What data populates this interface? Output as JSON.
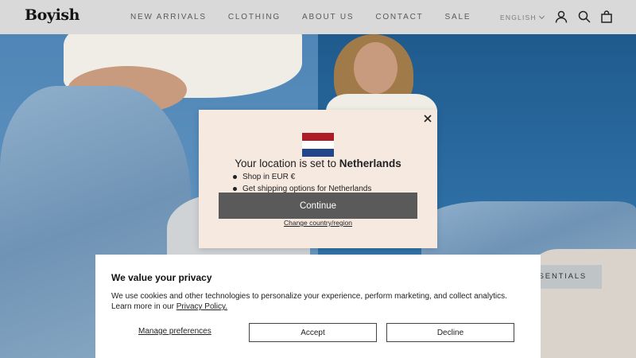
{
  "header": {
    "logo": "Boyish",
    "nav": [
      "NEW ARRIVALS",
      "CLOTHING",
      "ABOUT US",
      "CONTACT",
      "SALE"
    ],
    "language": "ENGLISH",
    "icons": [
      "account-icon",
      "search-icon",
      "cart-icon"
    ]
  },
  "hero": {
    "button_label": "SSENTIALS"
  },
  "location_modal": {
    "title_prefix": "Your location is set to ",
    "country": "Netherlands",
    "items": [
      "Shop in EUR €",
      "Get shipping options for Netherlands"
    ],
    "continue_label": "Continue",
    "change_label": "Change country/region",
    "flag_colors": [
      "#ae1c28",
      "#ffffff",
      "#21468b"
    ]
  },
  "cookie_banner": {
    "title": "We value your privacy",
    "text": "We use cookies and other technologies to personalize your experience, perform marketing, and collect analytics. Learn more in our ",
    "policy_link": "Privacy Policy.",
    "manage_label": "Manage preferences",
    "accept_label": "Accept",
    "decline_label": "Decline"
  }
}
